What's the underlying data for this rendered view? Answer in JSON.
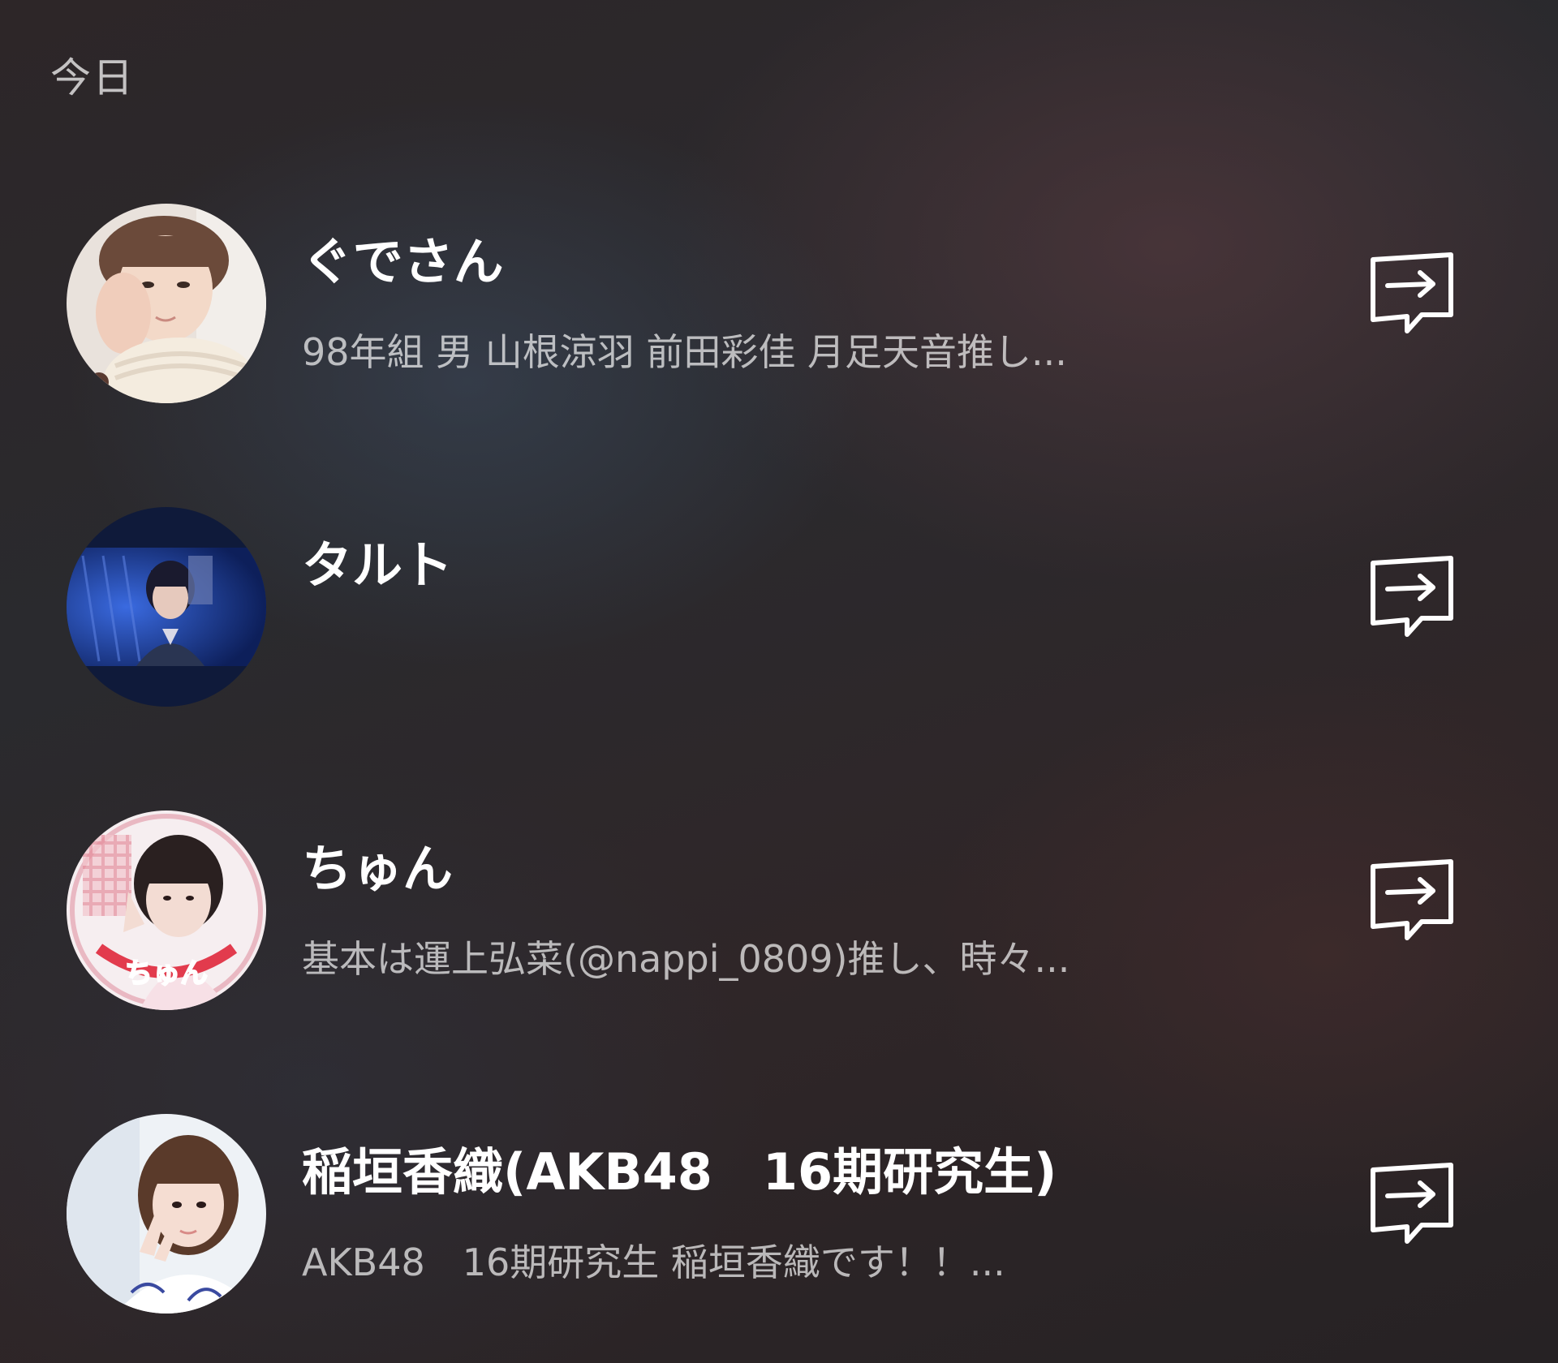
{
  "section": {
    "header": "今日"
  },
  "friends": [
    {
      "name": "ぐでさん",
      "status": "98年組 男 山根涼羽 前田彩佳 月足天音推し...",
      "avatar_icon": "profile-photo",
      "action_icon": "share-arrow-icon"
    },
    {
      "name": "タルト",
      "status": "",
      "avatar_icon": "profile-photo",
      "action_icon": "share-arrow-icon"
    },
    {
      "name": "ちゅん",
      "status": "基本は運上弘菜(@nappi_0809)推し、時々...",
      "avatar_icon": "profile-photo",
      "action_icon": "share-arrow-icon",
      "avatar_text": "ちゅん"
    },
    {
      "name": "稲垣香織(AKB48　16期研究生)",
      "status": "AKB48　16期研究生 稲垣香織です！！...",
      "avatar_icon": "profile-photo",
      "action_icon": "share-arrow-icon"
    }
  ],
  "colors": {
    "text_primary": "#ffffff",
    "text_secondary": "rgba(255,255,255,0.68)"
  }
}
